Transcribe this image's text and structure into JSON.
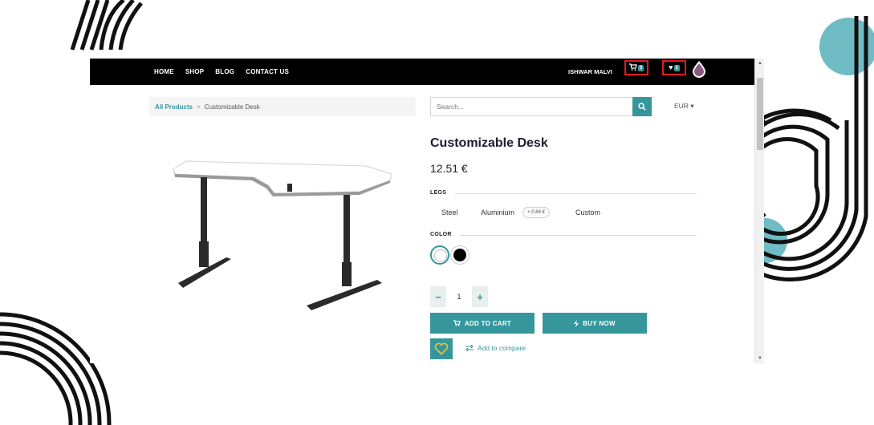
{
  "nav": {
    "links": [
      "HOME",
      "SHOP",
      "BLOG",
      "CONTACT US"
    ],
    "user": "ISHWAR MALVI",
    "cart_count": "3",
    "wishlist_count": "1"
  },
  "breadcrumb": {
    "root": "All Products",
    "separator": ">",
    "current": "Customizable Desk"
  },
  "search": {
    "placeholder": "Search..."
  },
  "currency": "EUR",
  "product": {
    "title": "Customizable Desk",
    "price": "12.51 €",
    "legs_label": "LEGS",
    "legs_options": [
      "Steel",
      "Aluminium",
      "Custom"
    ],
    "aluminium_extra": "+ 0.84 €",
    "color_label": "COLOR",
    "colors": [
      "#ffffff",
      "#000000"
    ],
    "quantity": "1"
  },
  "actions": {
    "add_to_cart": "ADD TO CART",
    "buy_now": "BUY NOW",
    "compare": "Add to compare"
  },
  "theme": {
    "accent": "#35979c",
    "navbar": "#000000",
    "highlight": "#e01b24"
  }
}
